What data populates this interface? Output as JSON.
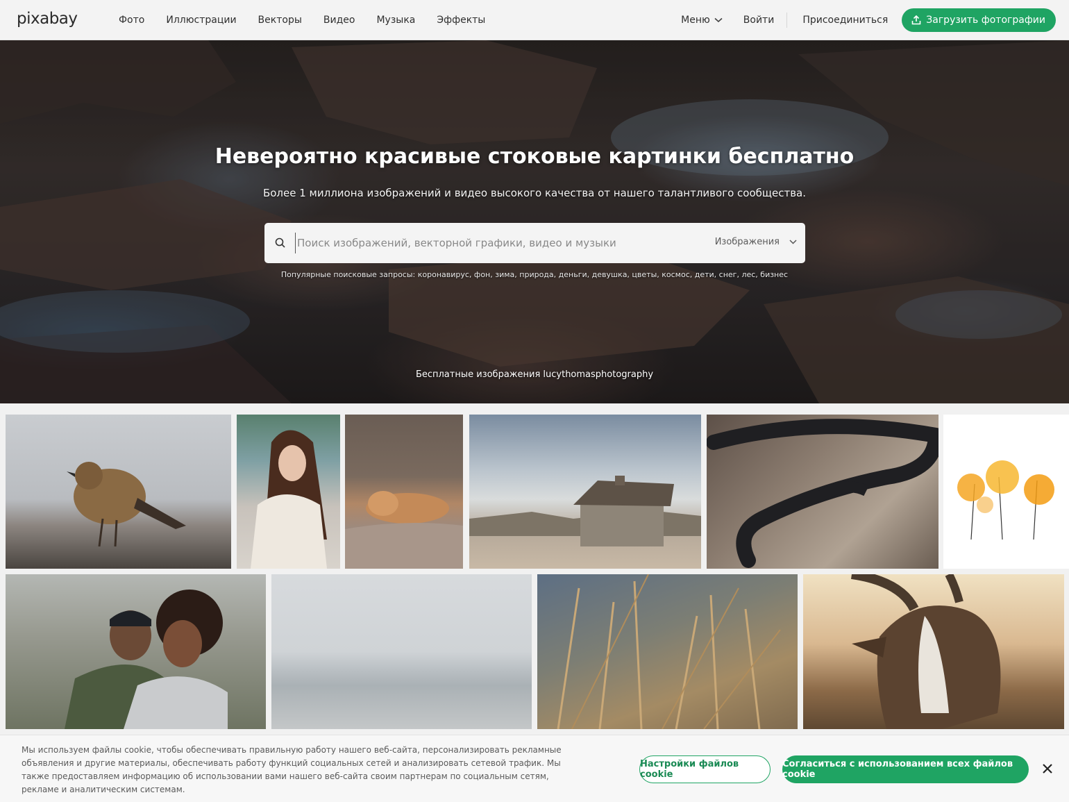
{
  "header": {
    "logo": "pixabay",
    "nav": [
      "Фото",
      "Иллюстрации",
      "Векторы",
      "Видео",
      "Музыка",
      "Эффекты"
    ],
    "menu_label": "Меню",
    "login_label": "Войти",
    "join_label": "Присоединиться",
    "upload_label": "Загрузить фотографии"
  },
  "hero": {
    "title": "Невероятно красивые стоковые картинки бесплатно",
    "subtitle": "Более 1 миллиона изображений и видео высокого качества от нашего талантливого сообщества.",
    "search_placeholder": "Поиск изображений, векторной графики, видео и музыки",
    "search_type": "Изображения",
    "popular": "Популярные поисковые запросы: коронавирус, фон, зима, природа, деньги, девушка, цветы, космос, дети, снег, лес, бизнес",
    "credit": "Бесплатные изображения lucythomasphotography"
  },
  "cookie": {
    "text": "Мы используем файлы cookie, чтобы обеспечивать правильную работу нашего веб-сайта, персонализировать рекламные объявления и другие материалы, обеспечивать работу функций социальных сетей и анализировать сетевой трафик. Мы также предоставляем информацию об использовании вами нашего веб-сайта своим партнерам по социальным сетям, рекламе и аналитическим системам.",
    "settings_label": "Настройки файлов cookie",
    "accept_label": "Согласиться с использованием всех файлов cookie"
  },
  "colors": {
    "accent": "#1fa463"
  }
}
